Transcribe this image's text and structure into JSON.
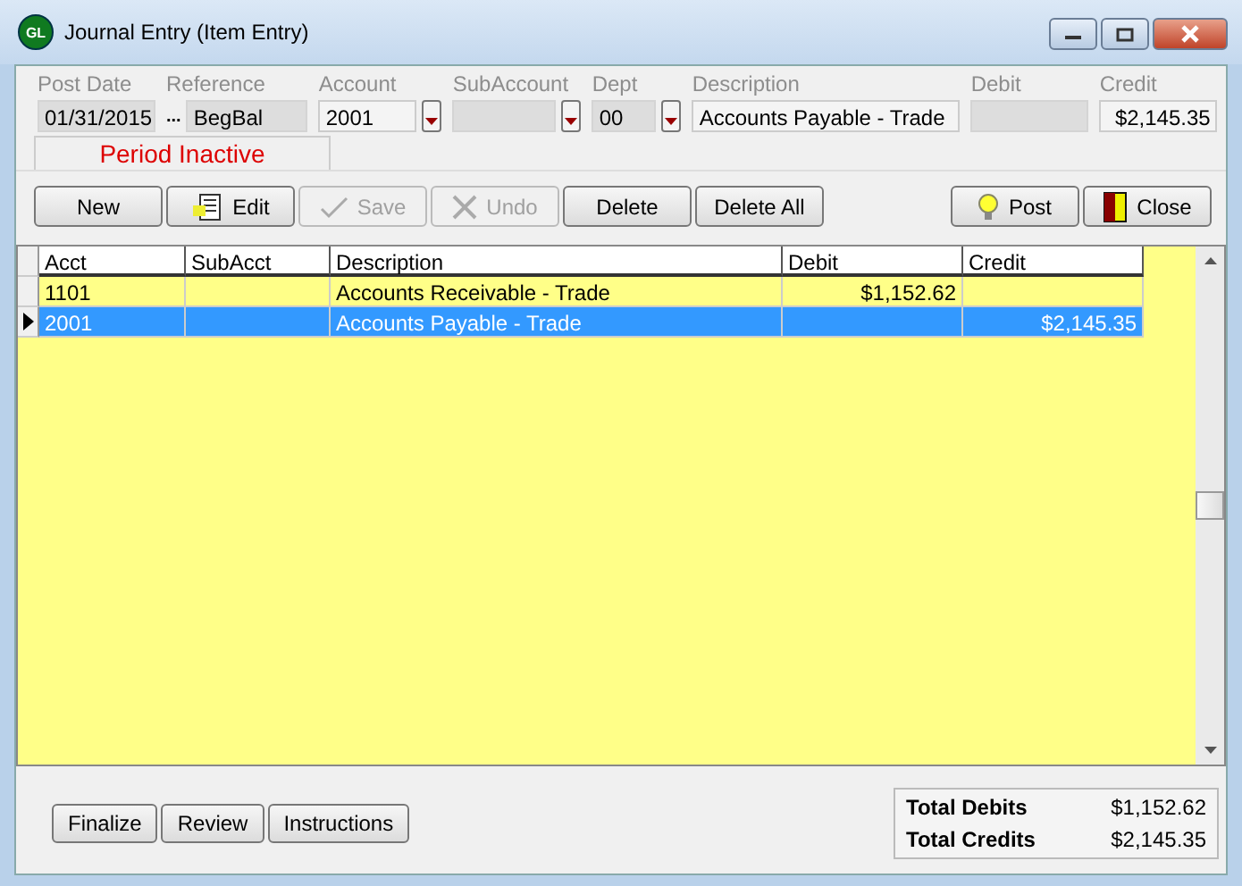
{
  "window": {
    "title": "Journal Entry (Item Entry)",
    "logo": "GL"
  },
  "header_fields": [
    {
      "label": "Post Date",
      "value": "01/31/2015",
      "disabled": true,
      "kind": "text"
    },
    {
      "label": "Reference",
      "value": "BegBal",
      "disabled": true,
      "kind": "text",
      "prefix": "..."
    },
    {
      "label": "Account",
      "value": "2001",
      "disabled": false,
      "kind": "lookup"
    },
    {
      "label": "SubAccount",
      "disabled": true,
      "kind": "lookup"
    },
    {
      "label": "Dept",
      "value": "00",
      "disabled": true,
      "kind": "lookup"
    },
    {
      "label": "Description",
      "value": "Accounts Payable - Trade",
      "disabled": false,
      "kind": "text"
    },
    {
      "label": "Debit",
      "disabled": true,
      "kind": "amount"
    },
    {
      "label": "Credit",
      "value": "$2,145.35",
      "disabled": false,
      "kind": "amount"
    }
  ],
  "period_status": "Period Inactive",
  "toolbar": [
    {
      "label": "New",
      "kind": "plain",
      "disabled": false
    },
    {
      "label": "Edit",
      "kind": "edit",
      "disabled": false
    },
    {
      "label": "Save",
      "kind": "save",
      "disabled": true
    },
    {
      "label": "Undo",
      "kind": "undo",
      "disabled": true
    },
    {
      "label": "Delete",
      "kind": "plain",
      "disabled": false
    },
    {
      "label": "Delete All",
      "kind": "plain",
      "disabled": false
    },
    {
      "label": "Post",
      "kind": "post",
      "disabled": false
    },
    {
      "label": "Close",
      "kind": "close",
      "disabled": false
    }
  ],
  "table": {
    "columns": [
      "Acct",
      "SubAcct",
      "Description",
      "Debit",
      "Credit"
    ],
    "rows": [
      {
        "cells": [
          "1101",
          null,
          "Accounts Receivable - Trade",
          "$1,152.62",
          null
        ],
        "selected": false
      },
      {
        "cells": [
          "2001",
          null,
          "Accounts Payable - Trade",
          null,
          "$2,145.35"
        ],
        "selected": true
      }
    ]
  },
  "footer_buttons": [
    "Finalize",
    "Review",
    "Instructions"
  ],
  "totals": [
    {
      "label": "Total Debits",
      "value": "$1,152.62"
    },
    {
      "label": "Total Credits",
      "value": "$2,145.35"
    }
  ]
}
